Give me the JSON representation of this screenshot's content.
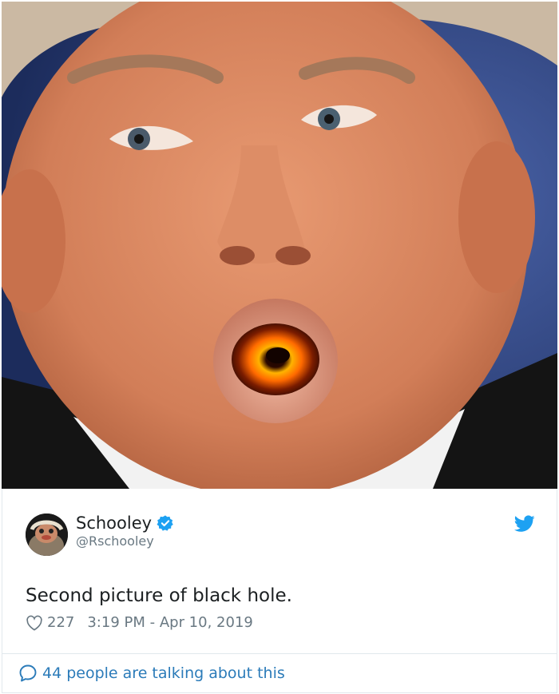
{
  "tweet": {
    "author_name": "Schooley",
    "author_handle": "@Rschooley",
    "text": "Second picture of black hole.",
    "likes": "227",
    "timestamp": "3:19 PM - Apr 10, 2019",
    "talking_text": "44 people are talking about this"
  },
  "colors": {
    "link_blue": "#2b7bb9",
    "twitter_blue": "#1da1f2",
    "secondary_gray": "#697882",
    "text_dark": "#1c2022",
    "border": "#e1e8ed"
  },
  "icons": {
    "verified": "verified-badge-icon",
    "twitter_logo": "twitter-bird-icon",
    "like": "heart-icon",
    "reply": "speech-bubble-icon"
  }
}
